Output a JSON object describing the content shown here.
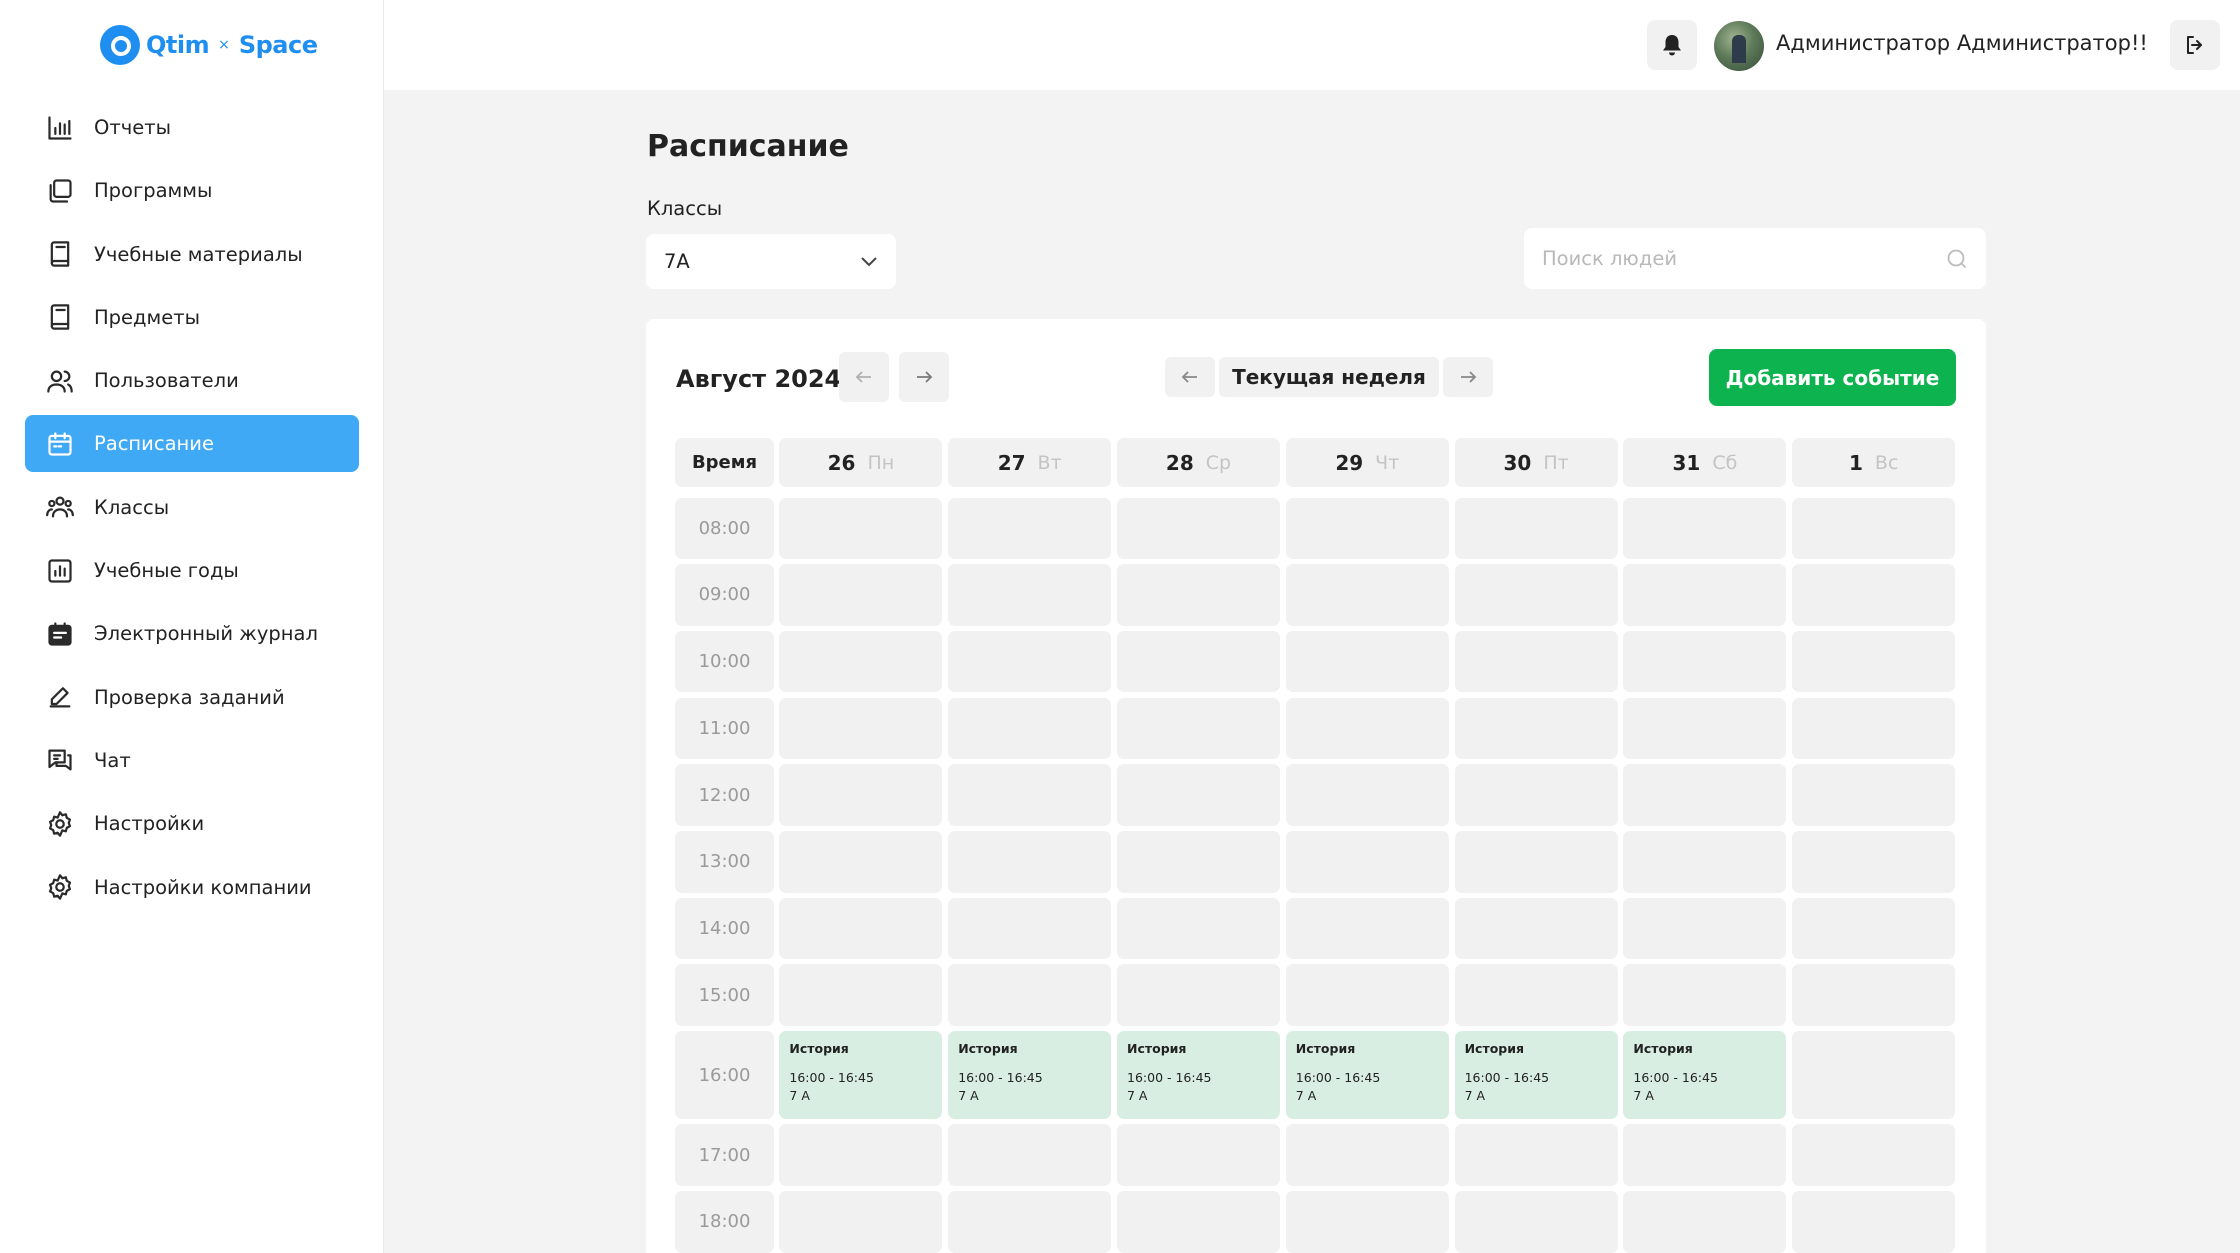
{
  "brand": {
    "name_left": "Qtim",
    "separator": "×",
    "name_right": "Space",
    "color": "#1f8ef1"
  },
  "sidebar": {
    "items": [
      {
        "label": "Отчеты",
        "icon": "bar-chart-icon",
        "active": false
      },
      {
        "label": "Программы",
        "icon": "copy-icon",
        "active": false
      },
      {
        "label": "Учебные материалы",
        "icon": "book-icon",
        "active": false
      },
      {
        "label": "Предметы",
        "icon": "book-icon",
        "active": false
      },
      {
        "label": "Пользователи",
        "icon": "users-icon",
        "active": false
      },
      {
        "label": "Расписание",
        "icon": "calendar-icon",
        "active": true
      },
      {
        "label": "Классы",
        "icon": "group-icon",
        "active": false
      },
      {
        "label": "Учебные годы",
        "icon": "chart-box-icon",
        "active": false
      },
      {
        "label": "Электронный журнал",
        "icon": "journal-icon",
        "active": false
      },
      {
        "label": "Проверка заданий",
        "icon": "pencil-icon",
        "active": false
      },
      {
        "label": "Чат",
        "icon": "chat-icon",
        "active": false
      },
      {
        "label": "Настройки",
        "icon": "gear-icon",
        "active": false
      },
      {
        "label": "Настройки компании",
        "icon": "gear-icon",
        "active": false
      }
    ],
    "active_color": "#3fa9f5"
  },
  "topbar": {
    "user_name": "Администратор Администратор!!",
    "bell_icon": "bell-icon",
    "logout_icon": "logout-icon"
  },
  "page": {
    "title": "Расписание",
    "classes_label": "Классы",
    "class_selected": "7А",
    "search_placeholder": "Поиск людей"
  },
  "calendar": {
    "month": "Август 2024",
    "current_week_label": "Текущая неделя",
    "add_event_label": "Добавить событие",
    "add_color": "#0cb34f",
    "time_header": "Время",
    "days": [
      {
        "date": "26",
        "weekday": "Пн"
      },
      {
        "date": "27",
        "weekday": "Вт"
      },
      {
        "date": "28",
        "weekday": "Ср"
      },
      {
        "date": "29",
        "weekday": "Чт"
      },
      {
        "date": "30",
        "weekday": "Пт"
      },
      {
        "date": "31",
        "weekday": "Сб"
      },
      {
        "date": "1",
        "weekday": "Вс"
      }
    ],
    "times": [
      "08:00",
      "09:00",
      "10:00",
      "11:00",
      "12:00",
      "13:00",
      "14:00",
      "15:00",
      "16:00",
      "17:00",
      "18:00"
    ],
    "events": [
      {
        "day": 0,
        "time": "16:00",
        "title": "История",
        "span": "16:00 - 16:45",
        "class": "7 А"
      },
      {
        "day": 1,
        "time": "16:00",
        "title": "История",
        "span": "16:00 - 16:45",
        "class": "7 А"
      },
      {
        "day": 2,
        "time": "16:00",
        "title": "История",
        "span": "16:00 - 16:45",
        "class": "7 А"
      },
      {
        "day": 3,
        "time": "16:00",
        "title": "История",
        "span": "16:00 - 16:45",
        "class": "7 А"
      },
      {
        "day": 4,
        "time": "16:00",
        "title": "История",
        "span": "16:00 - 16:45",
        "class": "7 А"
      },
      {
        "day": 5,
        "time": "16:00",
        "title": "История",
        "span": "16:00 - 16:45",
        "class": "7 А"
      }
    ],
    "event_color": "#d9eee3"
  }
}
